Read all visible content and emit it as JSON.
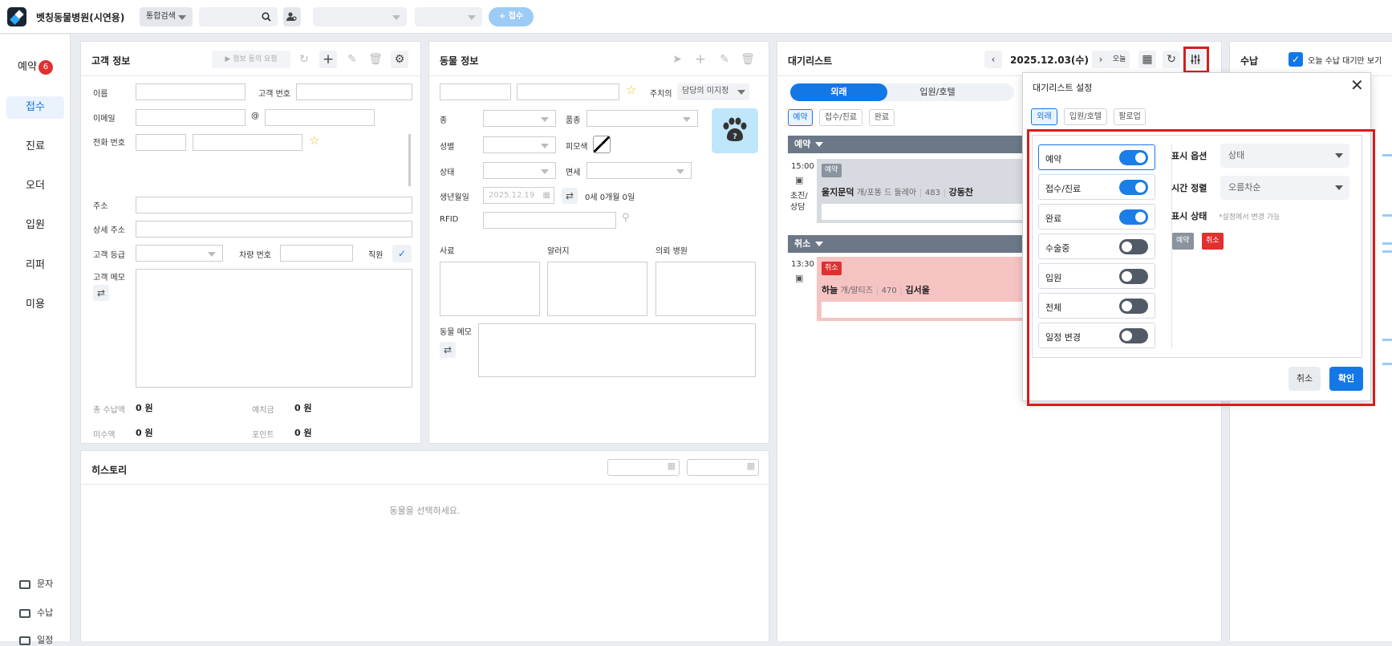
{
  "header": {
    "brand": "벳칭동물병원(시연용)",
    "search_scope": "통합검색",
    "register_btn": "+ 접수"
  },
  "leftnav": {
    "items": [
      "예약",
      "접수",
      "진료",
      "오더",
      "입원",
      "리퍼",
      "미용"
    ],
    "reservation_count": "6",
    "active": "접수",
    "bottom": [
      "문자",
      "수납",
      "일정"
    ]
  },
  "customer": {
    "title": "고객 정보",
    "consent_btn": "정보 동의 요청",
    "name_label": "이름",
    "number_label": "고객 번호",
    "email_label": "이메일",
    "email_at": "@",
    "phone_label": "전화 번호",
    "address_label": "주소",
    "address_detail_label": "상세 주소",
    "grade_label": "고객 등급",
    "car_label": "차량 번호",
    "staff_label": "직원",
    "memo_label": "고객 메모",
    "total_paid_label": "총 수납액",
    "total_paid": "0 원",
    "deposit_label": "예치금",
    "deposit": "0 원",
    "unpaid_label": "미수액",
    "unpaid": "0 원",
    "points_label": "포인트",
    "points": "0 원"
  },
  "animal": {
    "title": "동물 정보",
    "vet_label": "주치의",
    "vet_value": "담당의 미지정",
    "species_label": "종",
    "breed_label": "품종",
    "sex_label": "성별",
    "coat_label": "피모색",
    "status_label": "상태",
    "vaccine_label": "면세",
    "birth_label": "생년월일",
    "birth_placeholder": "2025.12.19",
    "age": "0세 0개월 0일",
    "rfid_label": "RFID",
    "feed_label": "사료",
    "allergy_label": "알러지",
    "referral_label": "의뢰 병원",
    "memo_label": "동물 메모"
  },
  "history": {
    "title": "히스토리",
    "empty": "동물을 선택하세요."
  },
  "waitlist": {
    "title": "대기리스트",
    "date": "2025.12.03(수)",
    "today_btn": "오늘",
    "seg_tabs": [
      "외래",
      "입원/호텔"
    ],
    "filter_tabs": [
      "예약",
      "접수/진료",
      "완료"
    ],
    "groups": [
      {
        "name": "예약",
        "time": "15:00",
        "sub": "초진/\n상담",
        "tag": "예약",
        "animal": "울지문덕",
        "breed": "개/포똥 드 둘레아",
        "no": "483",
        "owner": "강동찬"
      },
      {
        "name": "취소",
        "time": "13:30",
        "sub": "",
        "tag": "취소",
        "animal": "하늘",
        "breed": "개/말티즈",
        "no": "470",
        "owner": "김서울"
      }
    ]
  },
  "payment": {
    "title": "수납",
    "only_today": "오늘 수납 대기만 보기"
  },
  "modal": {
    "title": "대기리스트 설정",
    "tabs": [
      "외래",
      "입원/호텔",
      "팔로업"
    ],
    "toggles": [
      {
        "label": "예약",
        "on": true
      },
      {
        "label": "접수/진료",
        "on": true
      },
      {
        "label": "완료",
        "on": true
      },
      {
        "label": "수술중",
        "on": false
      },
      {
        "label": "입원",
        "on": false
      },
      {
        "label": "전체",
        "on": false
      },
      {
        "label": "일정 변경",
        "on": false
      }
    ],
    "display_option_label": "표시 옵션",
    "display_option_value": "상태",
    "time_sort_label": "시간 정렬",
    "time_sort_value": "오름차순",
    "display_status_label": "표시 상태",
    "display_status_hint": "*설정에서 변경 가능",
    "status_tags": [
      "예약",
      "취소"
    ],
    "cancel_btn": "취소",
    "confirm_btn": "확인"
  },
  "colors": {
    "accent": "#1477e6",
    "highlight": "#d91c1c",
    "cancel": "#e03131"
  }
}
